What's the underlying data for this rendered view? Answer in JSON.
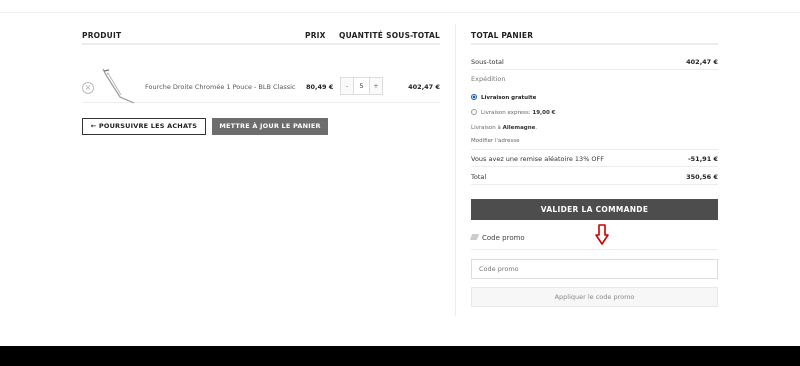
{
  "cart": {
    "headers": {
      "product": "PRODUIT",
      "price": "PRIX",
      "quantity": "QUANTITÉ",
      "subtotal": "SOUS-TOTAL"
    },
    "items": [
      {
        "remove": "×",
        "name": "Fourche Droite Chromée 1 Pouce - BLB Classic",
        "price": "80,49 €",
        "minus": "-",
        "quantity": "5",
        "plus": "+",
        "subtotal": "402,47 €"
      }
    ],
    "continue_label": "← POURSUIVRE LES ACHATS",
    "update_label": "METTRE À JOUR LE PANIER"
  },
  "totals": {
    "title": "TOTAL PANIER",
    "subtotal_label": "Sous-total",
    "subtotal_value": "402,47 €",
    "shipping_label": "Expédition",
    "shipping_options": [
      {
        "label": "Livraison gratuite",
        "price": "",
        "selected": true
      },
      {
        "label": "Livraison express: ",
        "price": "19,00 €",
        "selected": false
      }
    ],
    "delivery_to_prefix": "Livraison à ",
    "delivery_country": "Allemagne",
    "delivery_suffix": ".",
    "change_address": "Modifier l'adresse",
    "discount_label": "Vous avez une remise aléatoire 13% OFF",
    "discount_value": "-51,91 €",
    "total_label": "Total",
    "total_value": "350,56 €",
    "checkout_label": "VALIDER LA COMMANDE"
  },
  "coupon": {
    "heading": "Code promo",
    "placeholder": "Code promo",
    "apply_label": "Appliquer le code promo"
  },
  "colors": {
    "accent_radio": "#1a5fb4",
    "checkout_bg": "#4d4d4d",
    "arrow": "#cc0000",
    "footer": "#000000"
  }
}
